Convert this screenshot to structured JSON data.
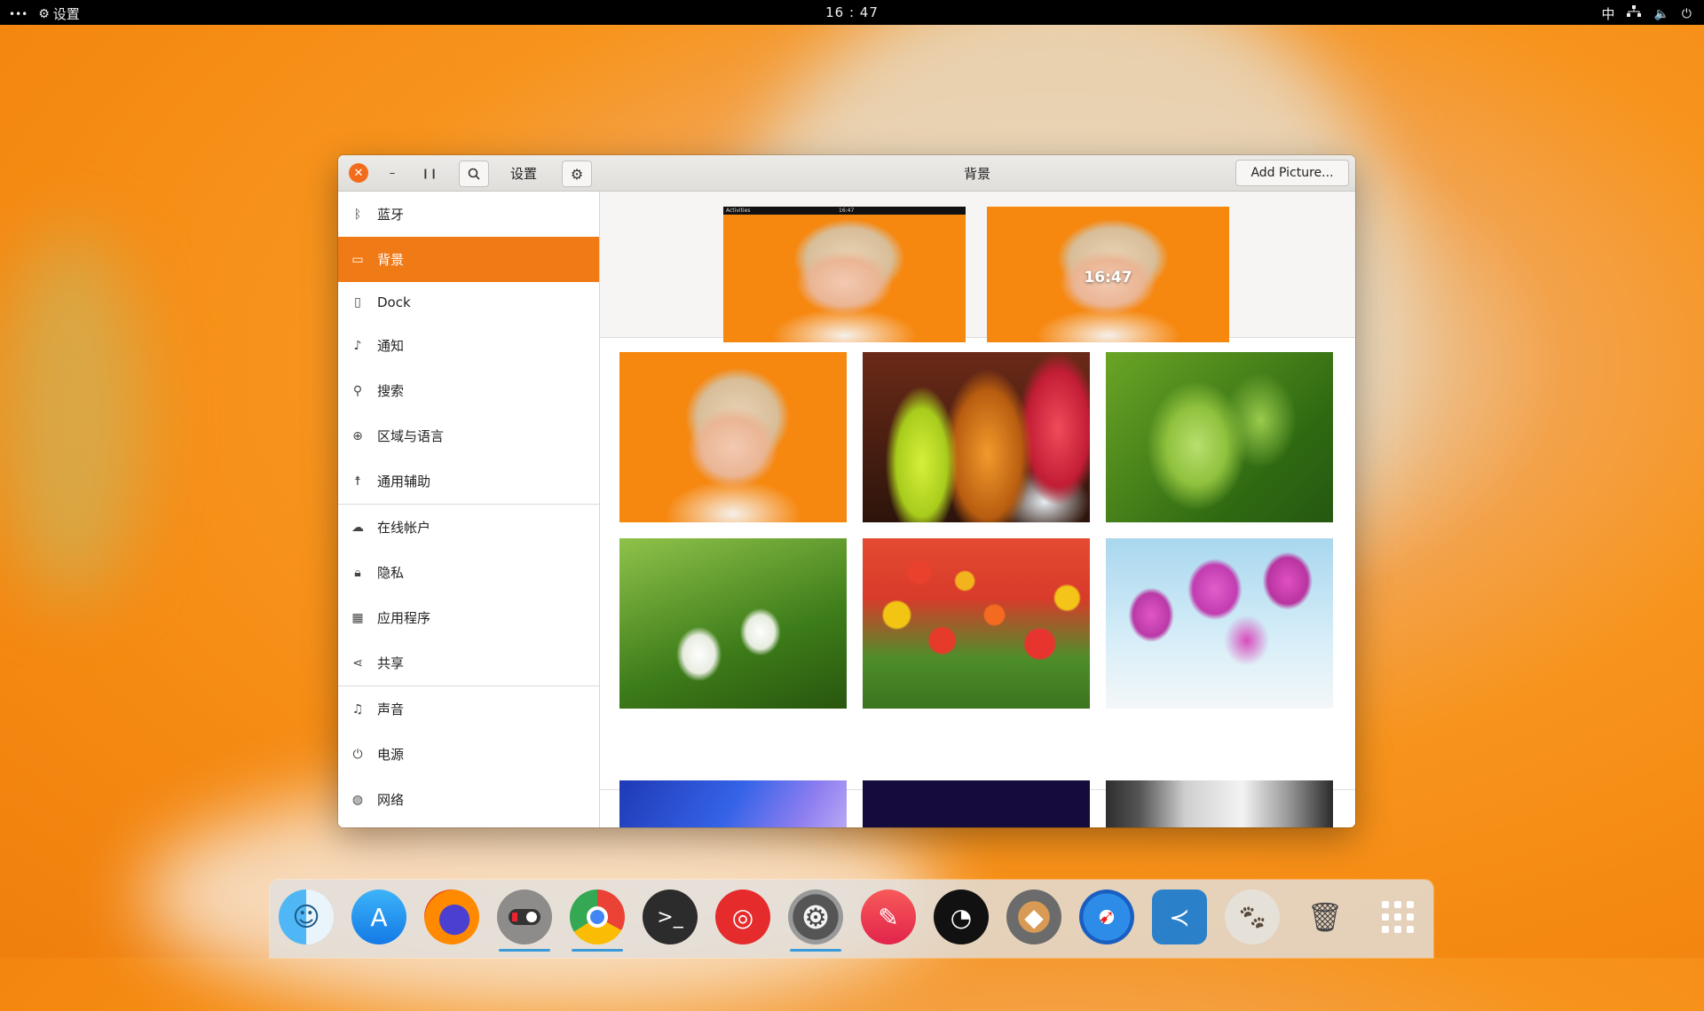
{
  "topbar": {
    "menu": "•••",
    "app_name": "设置",
    "clock": "16 : 47",
    "input_method": "中"
  },
  "window": {
    "left_title": "设置",
    "center_title": "背景",
    "add_button": "Add Picture..."
  },
  "sidebar": {
    "items": [
      {
        "label": "蓝牙",
        "icon": "bluetooth-icon"
      },
      {
        "label": "背景",
        "icon": "display-icon",
        "active": true
      },
      {
        "label": "Dock",
        "icon": "dock-icon"
      },
      {
        "label": "通知",
        "icon": "bell-icon"
      },
      {
        "label": "搜索",
        "icon": "search-icon"
      },
      {
        "label": "区域与语言",
        "icon": "globe-icon"
      },
      {
        "label": "通用辅助",
        "icon": "accessibility-icon"
      },
      {
        "label": "在线帐户",
        "icon": "cloud-icon"
      },
      {
        "label": "隐私",
        "icon": "lock-icon"
      },
      {
        "label": "应用程序",
        "icon": "apps-icon"
      },
      {
        "label": "共享",
        "icon": "share-icon"
      },
      {
        "label": "声音",
        "icon": "music-icon"
      },
      {
        "label": "电源",
        "icon": "power-icon"
      },
      {
        "label": "网络",
        "icon": "network-icon"
      }
    ]
  },
  "previews": {
    "desktop_bar_left": "Activities",
    "desktop_bar_clock": "16:47",
    "lock_clock": "16:47"
  },
  "dock": {
    "apps": [
      "finder",
      "app-store",
      "firefox",
      "toggle-app",
      "chrome",
      "terminal",
      "netease-music",
      "system-settings",
      "sketch-pen",
      "obs",
      "package-box",
      "safari",
      "vscode",
      "gimp",
      "trash",
      "app-grid"
    ]
  },
  "colors": {
    "accent": "#f07a16",
    "close": "#f36c1b",
    "topbar": "#000000"
  }
}
